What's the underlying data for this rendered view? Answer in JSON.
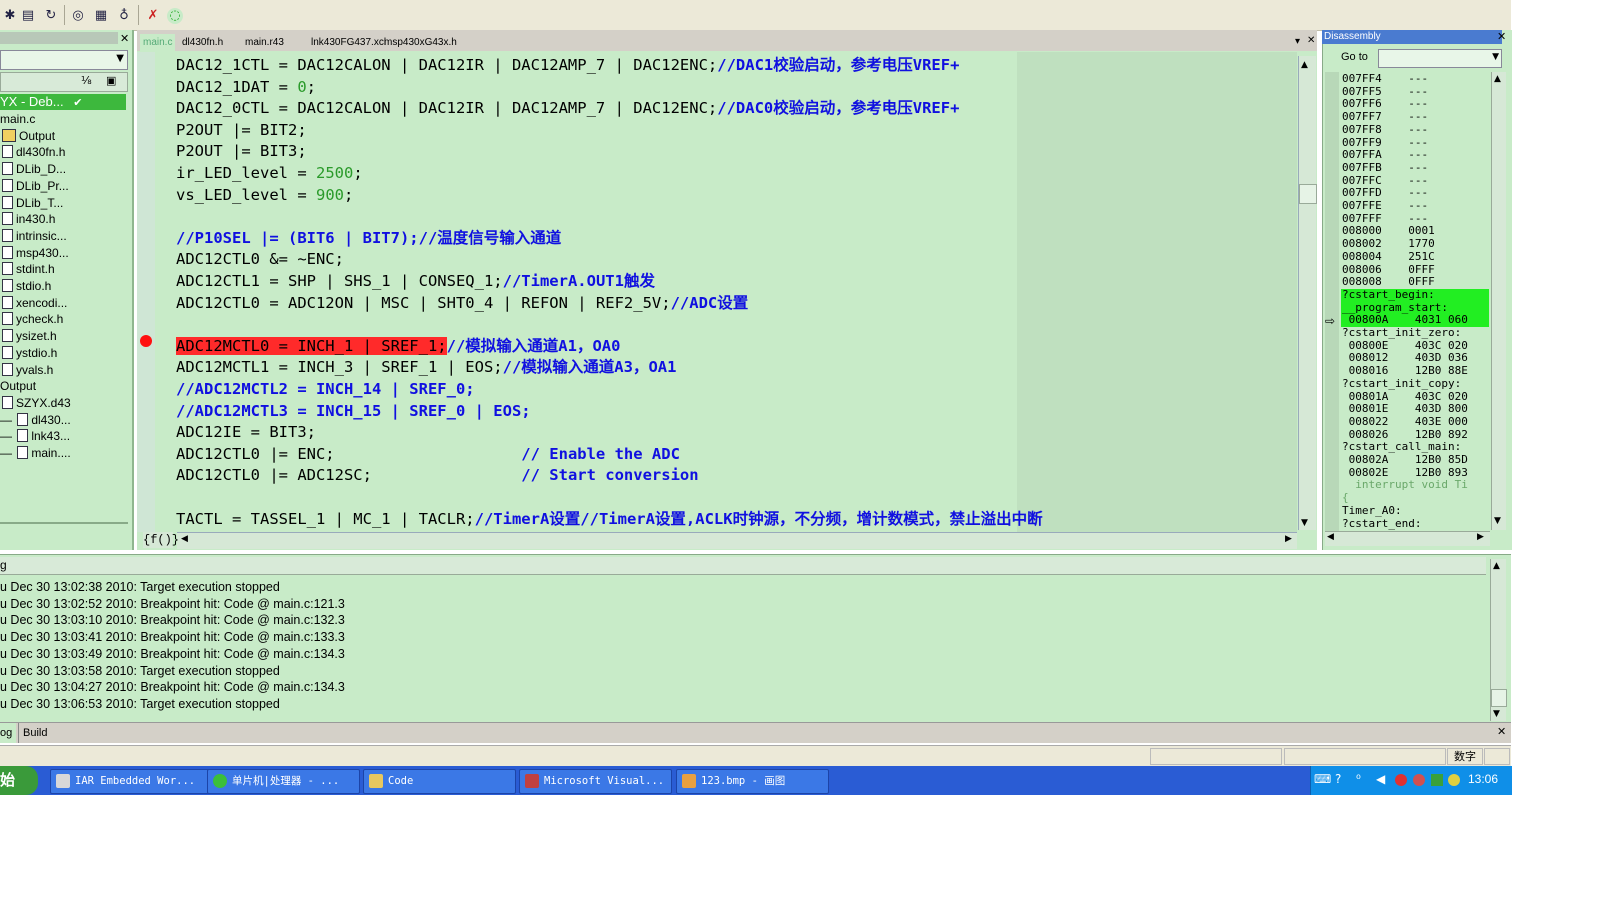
{
  "colors": {
    "panel_bg": "#c8ebc8",
    "comment": "#1010e0",
    "number": "#2a9a2a",
    "breakpoint": "#ff2a2a",
    "cursor_line": "#22ee22",
    "taskbar": "#2a5cd4"
  },
  "toolbar": {
    "icons": [
      "debug-step-icon",
      "debug-run-icon",
      "reset-icon",
      "watch-icon",
      "memory-icon",
      "register-icon",
      "breakpoint-remove-icon",
      "go-icon"
    ]
  },
  "workspace": {
    "project_header": "YX - Deb...",
    "items": [
      {
        "label": "main.c",
        "indent": 0,
        "icon": "none"
      },
      {
        "label": "Output",
        "indent": 0,
        "icon": "folder"
      },
      {
        "label": "dl430fn.h",
        "indent": 0,
        "icon": "file"
      },
      {
        "label": "DLib_D...",
        "indent": 0,
        "icon": "file"
      },
      {
        "label": "DLib_Pr...",
        "indent": 0,
        "icon": "file"
      },
      {
        "label": "DLib_T...",
        "indent": 0,
        "icon": "file"
      },
      {
        "label": "in430.h",
        "indent": 0,
        "icon": "file"
      },
      {
        "label": "intrinsic...",
        "indent": 0,
        "icon": "file"
      },
      {
        "label": "msp430...",
        "indent": 0,
        "icon": "file"
      },
      {
        "label": "stdint.h",
        "indent": 0,
        "icon": "file"
      },
      {
        "label": "stdio.h",
        "indent": 0,
        "icon": "file"
      },
      {
        "label": "xencodi...",
        "indent": 0,
        "icon": "file"
      },
      {
        "label": "ycheck.h",
        "indent": 0,
        "icon": "file"
      },
      {
        "label": "ysizet.h",
        "indent": 0,
        "icon": "file"
      },
      {
        "label": "ystdio.h",
        "indent": 0,
        "icon": "file"
      },
      {
        "label": "yvals.h",
        "indent": 0,
        "icon": "file"
      },
      {
        "label": "Output",
        "indent": 0,
        "icon": "none"
      },
      {
        "label": "SZYX.d43",
        "indent": 0,
        "icon": "file"
      },
      {
        "label": "dl430...",
        "indent": 1,
        "icon": "file"
      },
      {
        "label": "lnk43...",
        "indent": 1,
        "icon": "file"
      },
      {
        "label": "main....",
        "indent": 1,
        "icon": "file"
      }
    ]
  },
  "editor": {
    "tabs": [
      "main.c",
      "dl430fn.h",
      "main.r43",
      "lnk430FG437.xcl",
      "msp430xG43x.h"
    ],
    "func_combo": "{f()}",
    "lines": [
      {
        "code": "DAC12_1CTL = DAC12CALON | DAC12IR | DAC12AMP_7 | DAC12ENC;",
        "comment": "//DAC1校验启动，参考电压VREF+"
      },
      {
        "code": "DAC12_1DAT = ",
        "num": "0",
        "tail": ";"
      },
      {
        "code": "DAC12_0CTL = DAC12CALON | DAC12IR | DAC12AMP_7 | DAC12ENC;",
        "comment": "//DAC0校验启动，参考电压VREF+"
      },
      {
        "code": "P2OUT |= BIT2;"
      },
      {
        "code": "P2OUT |= BIT3;"
      },
      {
        "code": "ir_LED_level = ",
        "num": "2500",
        "tail": ";"
      },
      {
        "code": "vs_LED_level = ",
        "num": "900",
        "tail": ";"
      },
      {
        "code": ""
      },
      {
        "code": "",
        "comment": "//P10SEL |= (BIT6 | BIT7);//温度信号输入通道"
      },
      {
        "code": "ADC12CTL0 &= ~ENC;"
      },
      {
        "code": "ADC12CTL1 = SHP | SHS_1 | CONSEQ_1;",
        "comment": "//TimerA.OUT1触发"
      },
      {
        "code": "ADC12CTL0 = ADC12ON | MSC | SHT0_4 | REFON | REF2_5V;",
        "comment": "//ADC设置"
      },
      {
        "code": ""
      },
      {
        "code": "",
        "hl": "ADC12MCTL0 = INCH_1 | SREF_1;",
        "comment": "//模拟输入通道A1，OA0",
        "breakpoint": true
      },
      {
        "code": "ADC12MCTL1 = INCH_3 | SREF_1 | EOS;",
        "comment": "//模拟输入通道A3，OA1"
      },
      {
        "code": "",
        "comment": "//ADC12MCTL2 = INCH_14 | SREF_0;"
      },
      {
        "code": "",
        "comment": "//ADC12MCTL3 = INCH_15 | SREF_0 | EOS;"
      },
      {
        "code": "ADC12IE = BIT3;"
      },
      {
        "code": "ADC12CTL0 |= ENC;                    ",
        "comment": "// Enable the ADC"
      },
      {
        "code": "ADC12CTL0 |= ADC12SC;                ",
        "comment": "// Start conversion"
      },
      {
        "code": ""
      },
      {
        "code": "TACTL = TASSEL_1 | MC_1 | TACLR;",
        "comment": "//TimerA设置//TimerA设置,ACLK时钟源，不分频，增计数模式，禁止溢出中断"
      }
    ]
  },
  "disassembly": {
    "title": "Disassembly",
    "goto_label": "Go to",
    "lines": [
      {
        "text": "007FF4    ---",
        "kind": "addr"
      },
      {
        "text": "007FF5    ---",
        "kind": "addr"
      },
      {
        "text": "007FF6    ---",
        "kind": "addr"
      },
      {
        "text": "007FF7    ---",
        "kind": "addr"
      },
      {
        "text": "007FF8    ---",
        "kind": "addr"
      },
      {
        "text": "007FF9    ---",
        "kind": "addr"
      },
      {
        "text": "007FFA    ---",
        "kind": "addr"
      },
      {
        "text": "007FFB    ---",
        "kind": "addr"
      },
      {
        "text": "007FFC    ---",
        "kind": "addr"
      },
      {
        "text": "007FFD    ---",
        "kind": "addr"
      },
      {
        "text": "007FFE    ---",
        "kind": "addr"
      },
      {
        "text": "007FFF    ---",
        "kind": "addr"
      },
      {
        "text": "008000    0001",
        "kind": "addr"
      },
      {
        "text": "008002    1770",
        "kind": "addr"
      },
      {
        "text": "008004    251C",
        "kind": "addr"
      },
      {
        "text": "008006    0FFF",
        "kind": "addr"
      },
      {
        "text": "008008    0FFF",
        "kind": "addr"
      },
      {
        "text": "?cstart_begin:",
        "kind": "current-label"
      },
      {
        "text": "__program_start:",
        "kind": "current-label"
      },
      {
        "text": " 00800A    4031 060",
        "kind": "current"
      },
      {
        "text": "?cstart_init_zero:",
        "kind": "label"
      },
      {
        "text": " 00800E    403C 020",
        "kind": "addr"
      },
      {
        "text": " 008012    403D 036",
        "kind": "addr"
      },
      {
        "text": " 008016    12B0 88E",
        "kind": "addr"
      },
      {
        "text": "?cstart_init_copy:",
        "kind": "label"
      },
      {
        "text": " 00801A    403C 020",
        "kind": "addr"
      },
      {
        "text": " 00801E    403D 800",
        "kind": "addr"
      },
      {
        "text": " 008022    403E 000",
        "kind": "addr"
      },
      {
        "text": " 008026    12B0 892",
        "kind": "addr"
      },
      {
        "text": "?cstart_call_main:",
        "kind": "label"
      },
      {
        "text": " 00802A    12B0 85D",
        "kind": "addr"
      },
      {
        "text": " 00802E    12B0 893",
        "kind": "addr"
      },
      {
        "text": "  interrupt void Ti",
        "kind": "source"
      },
      {
        "text": "{",
        "kind": "source"
      },
      {
        "text": "Timer_A0:",
        "kind": "label"
      },
      {
        "text": "?cstart_end:",
        "kind": "label"
      }
    ]
  },
  "log": {
    "title": "g",
    "lines": [
      "u Dec 30 13:02:38 2010: Target execution stopped",
      "u Dec 30 13:02:52 2010: Breakpoint hit: Code @ main.c:121.3",
      "u Dec 30 13:03:10 2010: Breakpoint hit: Code @ main.c:132.3",
      "u Dec 30 13:03:41 2010: Breakpoint hit: Code @ main.c:133.3",
      "u Dec 30 13:03:49 2010: Breakpoint hit: Code @ main.c:134.3",
      "u Dec 30 13:03:58 2010: Target execution stopped",
      "u Dec 30 13:04:27 2010: Breakpoint hit: Code @ main.c:134.3",
      "u Dec 30 13:06:53 2010: Target execution stopped"
    ],
    "tabs": [
      "og",
      "Build"
    ]
  },
  "statusbar": {
    "ime": "数字"
  },
  "taskbar": {
    "start_label": "始",
    "tasks": [
      {
        "label": "IAR Embedded Wor...",
        "icon": "iar-icon",
        "color": "#d8d8d8"
      },
      {
        "label": "单片机|处理器 - ...",
        "icon": "browser-icon",
        "color": "#3bbf3b"
      },
      {
        "label": "Code",
        "icon": "folder-icon",
        "color": "#e8c860"
      },
      {
        "label": "Microsoft Visual...",
        "icon": "visual-studio-icon",
        "color": "#c04040"
      },
      {
        "label": "123.bmp - 画图",
        "icon": "paint-icon",
        "color": "#e8a040"
      }
    ],
    "clock": "13:06"
  }
}
